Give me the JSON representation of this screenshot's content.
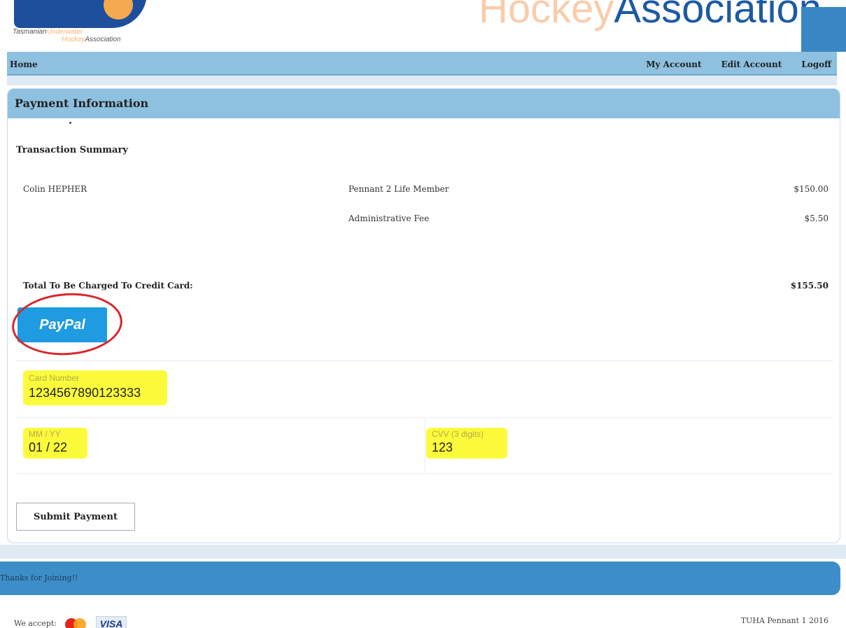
{
  "header": {
    "logo_text_1": "Tasmanian",
    "logo_text_2": "Underwater",
    "logo_text_3": "Hockey",
    "logo_text_4": "Association",
    "banner_part1": "Hockey",
    "banner_part2": "Association"
  },
  "nav": {
    "home": "Home",
    "my_account": "My Account",
    "edit_account": "Edit Account",
    "logoff": "Logoff"
  },
  "panel": {
    "title": "Payment Information",
    "summary_title": "Transaction Summary",
    "items": [
      {
        "name": "Colin HEPHER",
        "description": "Pennant 2 Life Member",
        "amount": "$150.00"
      },
      {
        "name": "",
        "description": "Administrative Fee",
        "amount": "$5.50"
      }
    ],
    "total_label": "Total To Be Charged To Credit Card:",
    "total_value": "$155.50",
    "paypal_label": "PayPal"
  },
  "card": {
    "number_label": "Card Number",
    "number_value": "1234567890123333",
    "expiry_label": "MM / YY",
    "expiry_value": "01 / 22",
    "cvv_label": "CVV (3 digits)",
    "cvv_value": "123"
  },
  "submit_label": "Submit Payment",
  "thanks": "Thanks for Joining!!",
  "footer": {
    "accept_label": "We accept:",
    "visa_label": "VISA",
    "copyright": "TUHA Pennant 1 2016"
  },
  "colors": {
    "nav_bg": "#8ec0e0",
    "paypal_blue": "#1f9be1",
    "highlight": "#fbfb3c",
    "annotation_red": "#d9262a"
  }
}
